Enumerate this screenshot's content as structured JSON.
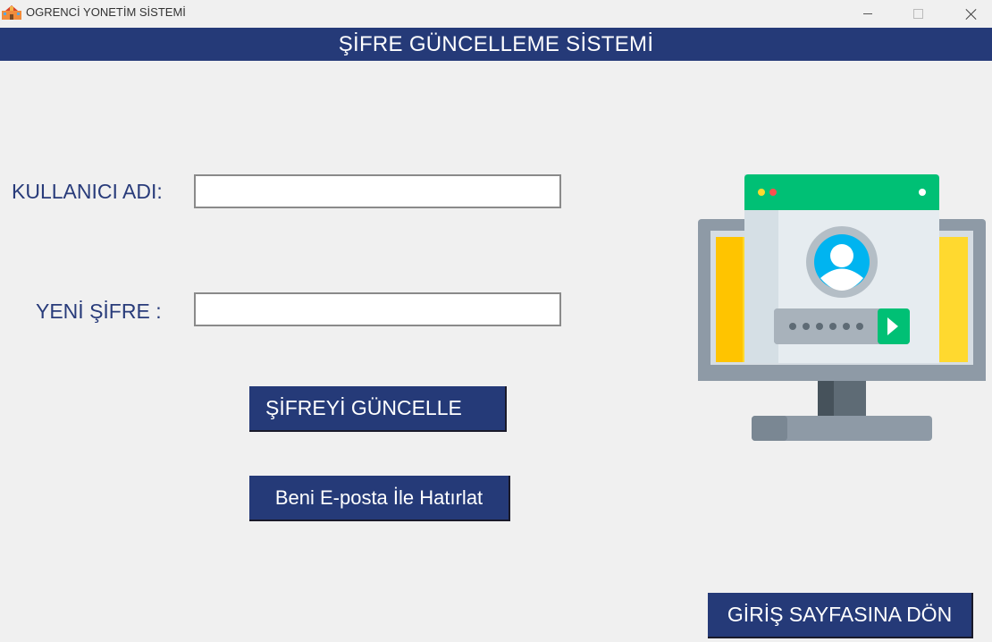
{
  "window": {
    "title": "OGRENCİ YONETİM SİSTEMİ",
    "icon": "school-building-icon",
    "controls": [
      "minimize-icon",
      "maximize-icon",
      "close-icon"
    ]
  },
  "header": {
    "title": "ŞİFRE GÜNCELLEME SİSTEMİ"
  },
  "form": {
    "username_label": "KULLANICI ADI:",
    "username_value": "",
    "password_label": "YENİ ŞİFRE :",
    "password_value": ""
  },
  "buttons": {
    "update_label": "ŞİFREYİ  GÜNCELLE",
    "email_label": "Beni E-posta İle Hatırlat",
    "back_label": "GİRİŞ SAYFASINA DÖN"
  },
  "illustration": {
    "icon": "computer-login-illustration"
  },
  "colors": {
    "primary": "#253a78",
    "background": "#f0f0f0",
    "label_text": "#283b7a",
    "field_border": "#8a8a8a",
    "illustration_green": "#00c075",
    "illustration_yellow": "#ffd92f",
    "illustration_blue": "#00b4f0"
  }
}
